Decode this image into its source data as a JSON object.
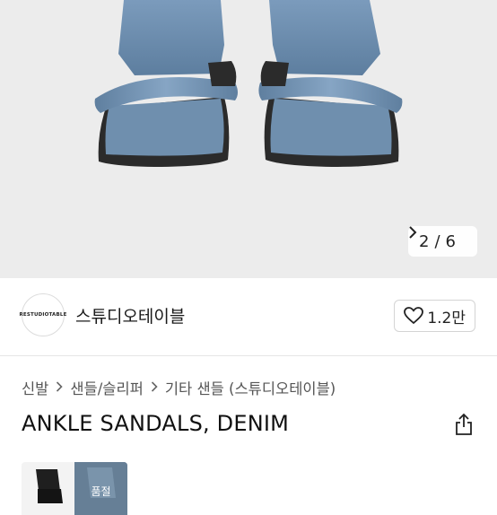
{
  "gallery": {
    "current": "2",
    "separator": "/",
    "total": "6",
    "next_icon": "chevron-right-icon"
  },
  "store": {
    "logo_text": "RESTUDIOTABLE",
    "name": "스튜디오테이블",
    "like_icon": "heart-outline-icon",
    "like_count": "1.2만"
  },
  "breadcrumb": {
    "items": [
      "신발",
      "샌들/슬리퍼",
      "기타 샌들 (스튜디오테이블)"
    ],
    "separator_icon": "chevron-right-icon"
  },
  "product": {
    "title": "ANKLE SANDALS, DENIM",
    "share_icon": "share-icon"
  },
  "color_options": [
    {
      "name": "black-thumb",
      "label": ""
    },
    {
      "name": "denim-thumb",
      "label": "품절"
    }
  ],
  "colors": {
    "denim": "#6d8eae",
    "sole": "#2a2a2a",
    "background": "#ececec"
  }
}
